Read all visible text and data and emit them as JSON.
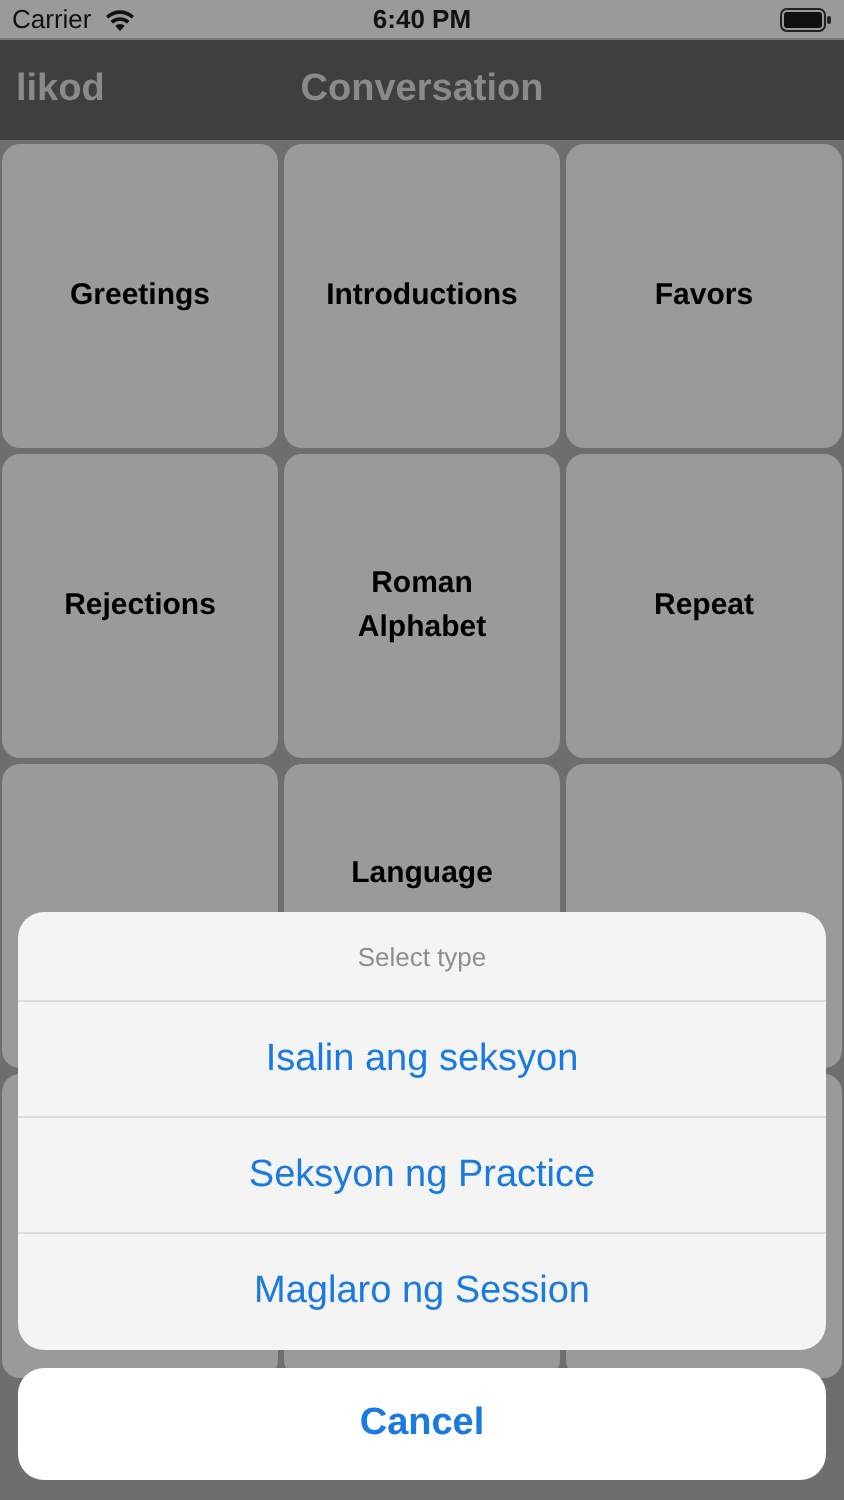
{
  "status_bar": {
    "carrier": "Carrier",
    "time": "6:40 PM"
  },
  "nav_bar": {
    "back": "likod",
    "title": "Conversation"
  },
  "tiles": [
    {
      "kind": "labeled",
      "label": "Greetings"
    },
    {
      "kind": "labeled",
      "label": "Introductions"
    },
    {
      "kind": "labeled",
      "label": "Favors"
    },
    {
      "kind": "labeled",
      "label": "Rejections"
    },
    {
      "kind": "labeled",
      "label": "Roman Alphabet"
    },
    {
      "kind": "labeled",
      "label": "Repeat"
    },
    {
      "kind": "covered"
    },
    {
      "kind": "labeled",
      "label": "Language"
    },
    {
      "kind": "covered"
    }
  ],
  "action_sheet": {
    "title": "Select type",
    "options": [
      "Isalin ang seksyon",
      "Seksyon ng Practice",
      "Maglaro ng Session"
    ],
    "cancel": "Cancel"
  }
}
